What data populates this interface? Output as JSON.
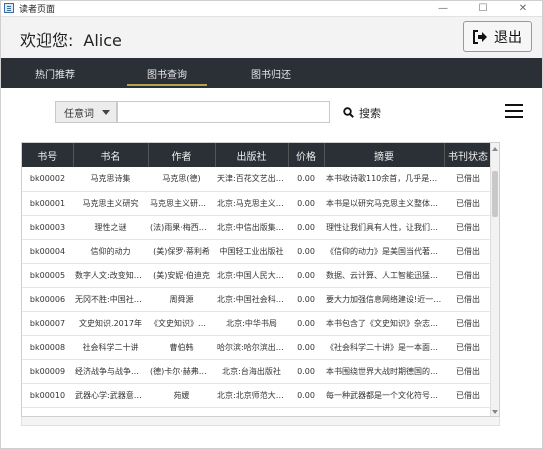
{
  "window": {
    "title": "读者页面",
    "min": "—",
    "max": "☐",
    "close": "✕"
  },
  "header": {
    "welcome": "欢迎您:",
    "username": "Alice",
    "logout_label": "退出"
  },
  "nav": {
    "tabs": [
      {
        "label": "热门推荐"
      },
      {
        "label": "图书查询"
      },
      {
        "label": "图书归还"
      }
    ]
  },
  "search": {
    "type_selected": "任意词",
    "placeholder": "",
    "value": "",
    "button_label": "搜索"
  },
  "table": {
    "headers": [
      "书号",
      "书名",
      "作者",
      "出版社",
      "价格",
      "摘要",
      "书刊状态"
    ],
    "rows": [
      [
        "bk00002",
        "马克思诗集",
        "马克思(德)",
        "天津:百花文艺出版社",
        "0.00",
        "本书收诗歌110余首，几乎是马克...",
        "已借出"
      ],
      [
        "bk00001",
        "马克思主义研究",
        "马克思主义研究...",
        "北京:马克思主义研...",
        "0.00",
        "本书是以研究马克思主义整体理论...",
        "已借出"
      ],
      [
        "bk00003",
        "理性之谜",
        "(法)雨果·梅西耶(...",
        "北京:中信出版集团...",
        "0.00",
        "理性让我们具有人性，让我们获取...",
        "已借出"
      ],
      [
        "bk00004",
        "信仰的动力",
        "(美)保罗·蒂利希",
        "中国轻工业出版社",
        "0.00",
        "《信仰的动力》是美国当代著名哲...",
        "已借出"
      ],
      [
        "bk00005",
        "数字人文:改变知识...",
        "(美)安妮·伯迪克",
        "北京:中国人民大学...",
        "0.00",
        "数据、云计算、人工智能迅猛发展...",
        "已借出"
      ],
      [
        "bk00006",
        "无冈不胜:中国社会...",
        "周舜源",
        "北京:中国社会科学...",
        "0.00",
        "要大力加强信息网络建设!近一二...",
        "已借出"
      ],
      [
        "bk00007",
        "文史知识.2017年",
        "《文史知识》编...",
        "北京:中华书局",
        "0.00",
        "本书包含了《文史知识》杂志2017...",
        "已借出"
      ],
      [
        "bk00008",
        "社会科学二十讲",
        "曹伯韩",
        "哈尔滨:哈尔滨出版社",
        "0.00",
        "《社会科学二十讲》是一本面向普...",
        "已借出"
      ],
      [
        "bk00009",
        "经济战争与战争经济",
        "(德)卡尔·赫弗里希",
        "北京:台海出版社",
        "0.00",
        "本书围绕世界大战时期德国的战争手...",
        "已借出"
      ],
      [
        "bk00010",
        "武器心学:武器意象...",
        "苑媛",
        "北京:北京师范大学...",
        "0.00",
        "每一种武器都是一个文化符号，完...",
        "已借出"
      ]
    ]
  }
}
